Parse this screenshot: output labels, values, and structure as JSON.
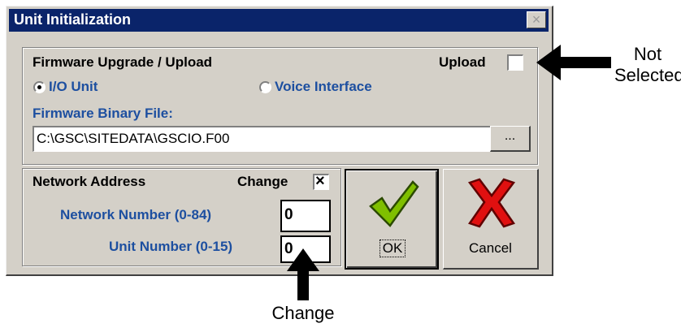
{
  "dialog": {
    "title": "Unit Initialization",
    "close_label": "×"
  },
  "firmware": {
    "heading": "Firmware Upgrade / Upload",
    "upload_label": "Upload",
    "radio_io": "I/O Unit",
    "radio_voice": "Voice Interface",
    "file_label": "Firmware Binary File:",
    "file_path": "C:\\GSC\\SITEDATA\\GSCIO.F00",
    "browse_label": "..."
  },
  "network": {
    "heading": "Network Address",
    "change_label": "Change",
    "change_mark": "×",
    "network_number_label": "Network Number (0-84)",
    "network_number_value": "0",
    "unit_number_label": "Unit Number (0-15)",
    "unit_number_value": "0"
  },
  "buttons": {
    "ok_label": "OK",
    "cancel_label": "Cancel"
  },
  "annotations": {
    "not_selected_line1": "Not",
    "not_selected_line2": "Selected",
    "change": "Change"
  },
  "colors": {
    "titlebar": "#0a246a",
    "label_blue": "#1d4fa0",
    "ok_green": "#7fbf00",
    "cancel_red": "#e01010"
  }
}
